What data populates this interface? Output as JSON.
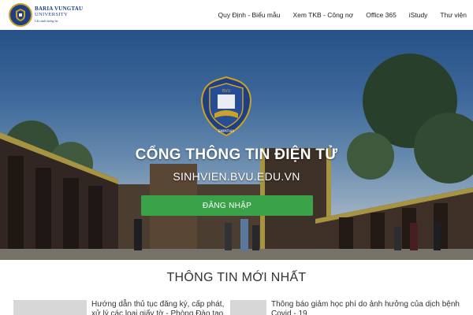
{
  "brand": {
    "name": "BARIA VUNGTAU",
    "sub": "UNIVERSITY",
    "motto": "Cất cánh tương lai"
  },
  "nav": {
    "items": [
      {
        "label": "Quy Định - Biểu mẫu"
      },
      {
        "label": "Xem TKB - Công nợ"
      },
      {
        "label": "Office 365"
      },
      {
        "label": "iStudy"
      },
      {
        "label": "Thư viện"
      }
    ]
  },
  "hero": {
    "title": "CỔNG THÔNG TIN ĐIỆN TỬ",
    "subtitle": "SINHVIEN.BVU.EDU.VN",
    "login_label": "ĐĂNG NHẬP",
    "emblem_text": "BVU",
    "emblem_motto": "EMPATHIA"
  },
  "news": {
    "title": "THÔNG TIN MỚI NHẤT",
    "items": [
      {
        "text": "Hướng dẫn thủ tục đăng ký, cấp phát, xử lý các loại giấy tờ - Phòng Đào tạo"
      },
      {
        "text": "Thông báo giảm học phí do ảnh hưởng của dịch bệnh Covid - 19"
      }
    ]
  },
  "colors": {
    "accent": "#3aa34a",
    "brand": "#1f3f82",
    "gold": "#c9a227"
  }
}
